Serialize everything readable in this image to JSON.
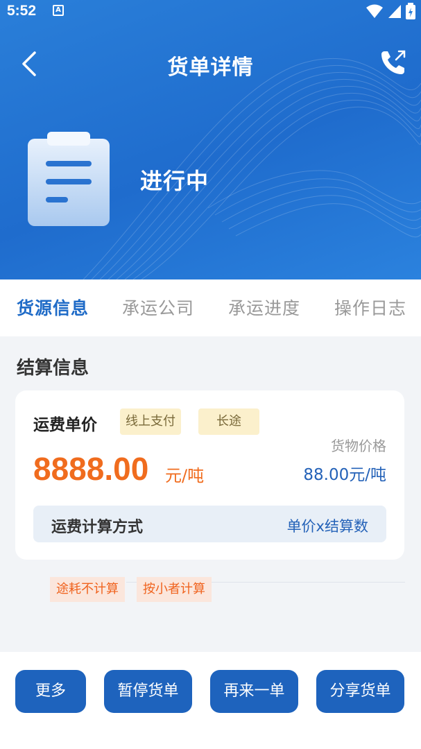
{
  "status_bar": {
    "time": "5:52",
    "notification_badge": "A"
  },
  "header": {
    "title": "货单详情",
    "back_icon": "chevron-left-icon",
    "phone_icon": "phone-icon"
  },
  "order": {
    "status": "进行中"
  },
  "tabs": [
    {
      "label": "货源信息",
      "active": true
    },
    {
      "label": "承运公司",
      "active": false
    },
    {
      "label": "承运进度",
      "active": false
    },
    {
      "label": "操作日志",
      "active": false
    }
  ],
  "settlement": {
    "section_title": "结算信息",
    "fee_label": "运费单价",
    "tags": [
      "线上支付",
      "长途"
    ],
    "price": "8888.00",
    "price_unit": "元/吨",
    "goods_price_label": "货物价格",
    "goods_price_value": "88.00元/吨",
    "calc_method_label": "运费计算方式",
    "calc_method_value": "单价x结算数"
  },
  "extra_tags": [
    "途耗不计算",
    "按小者计算"
  ],
  "actions": [
    "更多",
    "暂停货单",
    "再来一单",
    "分享货单"
  ],
  "colors": {
    "primary": "#1e63bd",
    "accent": "#f06c1e",
    "tag_bg": "#fbf0cc",
    "header_bg": "#2a7fd9"
  }
}
